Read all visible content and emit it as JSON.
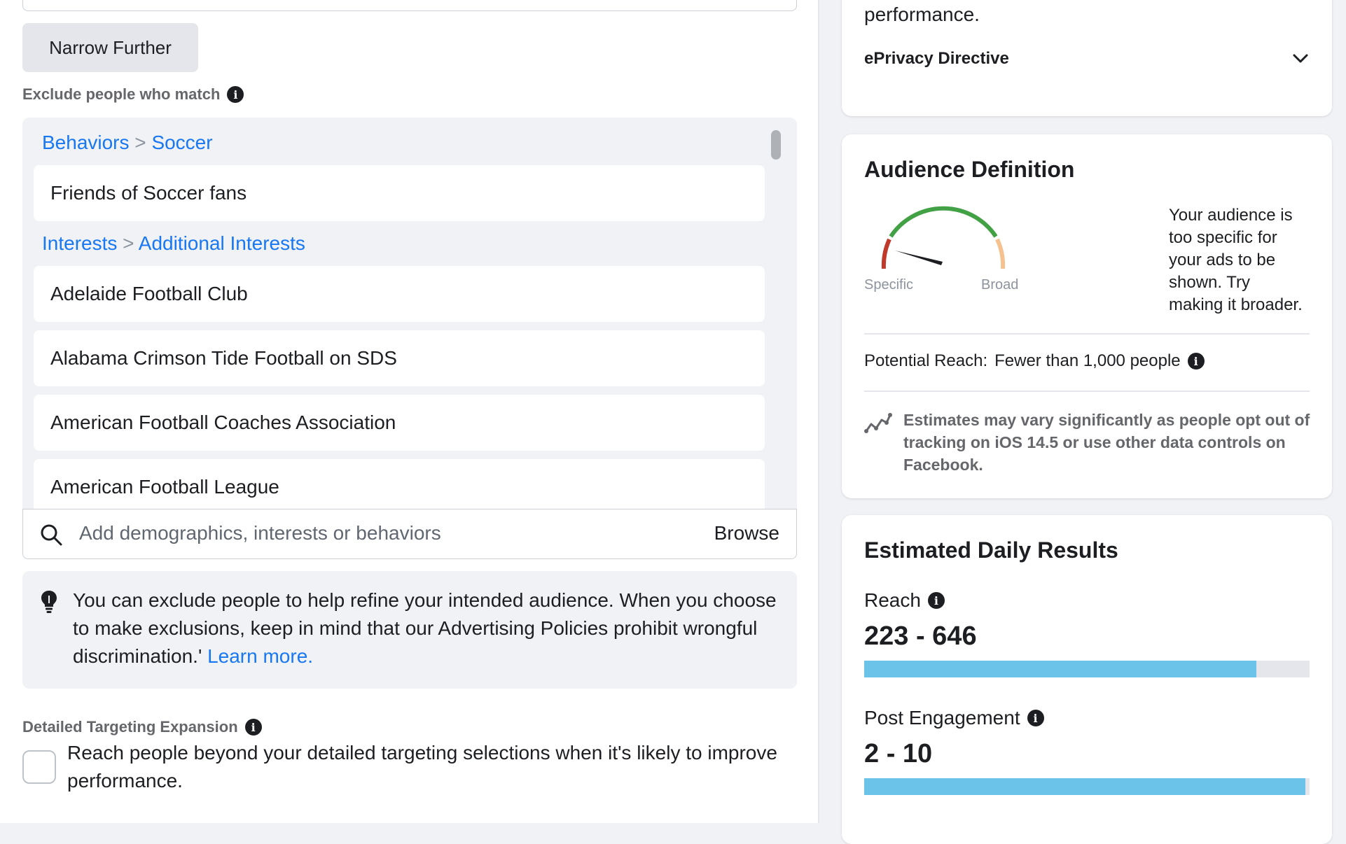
{
  "left": {
    "narrow_button": "Narrow Further",
    "exclude_label": "Exclude people who match",
    "groups": [
      {
        "crumb_a": "Behaviors",
        "crumb_sep": ">",
        "crumb_b": "Soccer",
        "items": [
          "Friends of Soccer fans"
        ]
      },
      {
        "crumb_a": "Interests",
        "crumb_sep": ">",
        "crumb_b": "Additional Interests",
        "items": [
          "Adelaide Football Club",
          "Alabama Crimson Tide Football on SDS",
          "American Football Coaches Association",
          "American Football League"
        ]
      }
    ],
    "search": {
      "placeholder": "Add demographics, interests or behaviors",
      "browse": "Browse"
    },
    "notice": {
      "text": "You can exclude people to help refine your intended audience. When you choose to make exclusions, keep in mind that our Advertising Policies prohibit wrongful discrimination.'",
      "link": "Learn more."
    },
    "expansion": {
      "label": "Detailed Targeting Expansion",
      "checkbox_text": "Reach people beyond your detailed targeting selections when it's likely to improve performance.",
      "checked": false
    }
  },
  "right": {
    "card1": {
      "text": "performance.",
      "eprivacy": "ePrivacy Directive"
    },
    "audience": {
      "title": "Audience Definition",
      "gauge_left": "Specific",
      "gauge_right": "Broad",
      "message": "Your audience is too specific for your ads to be shown. Try making it broader.",
      "potential_reach_label": "Potential Reach:",
      "potential_reach_value": "Fewer than 1,000 people",
      "estimate_note": "Estimates may vary significantly as people opt out of tracking on iOS 14.5 or use other data controls on Facebook."
    },
    "daily": {
      "title": "Estimated Daily Results",
      "reach_label": "Reach",
      "reach_value": "223 - 646",
      "reach_fill_fraction": 0.88,
      "engagement_label": "Post Engagement",
      "engagement_value": "2 - 10",
      "engagement_fill_fraction": 0.99
    }
  },
  "colors": {
    "link": "#1877f2",
    "bar_fill": "#6cc3ea",
    "gauge_green": "#42a045",
    "gauge_red": "#c0392b",
    "gauge_peach": "#f5c28f"
  },
  "icons": {
    "info": "info-icon",
    "search": "search-icon",
    "bulb": "lightbulb-icon",
    "chevron": "chevron-down-icon",
    "trend": "trend-icon"
  }
}
